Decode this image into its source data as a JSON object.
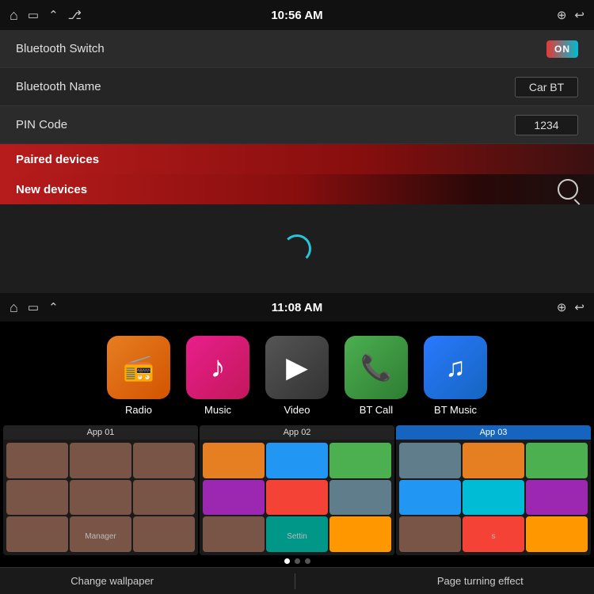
{
  "top_panel": {
    "status_bar": {
      "time": "10:56 AM",
      "icons_left": [
        "home",
        "screen",
        "chevron-up",
        "usb"
      ],
      "icons_right": [
        "location",
        "back"
      ]
    },
    "settings": [
      {
        "label": "Bluetooth Switch",
        "type": "toggle",
        "value": "ON"
      },
      {
        "label": "Bluetooth Name",
        "type": "value",
        "value": "Car BT"
      },
      {
        "label": "PIN Code",
        "type": "value",
        "value": "1234"
      }
    ],
    "sections": [
      {
        "label": "Paired devices",
        "type": "header"
      },
      {
        "label": "New devices",
        "type": "header-search"
      }
    ]
  },
  "bottom_panel": {
    "status_bar": {
      "time": "11:08 AM",
      "icons_left": [
        "home",
        "screen",
        "chevron-up"
      ],
      "icons_right": [
        "location",
        "back"
      ]
    },
    "apps": [
      {
        "id": "radio",
        "label": "Radio",
        "icon_class": "app-icon-radio",
        "icon_char": "📻"
      },
      {
        "id": "music",
        "label": "Music",
        "icon_class": "app-icon-music",
        "icon_char": "♪"
      },
      {
        "id": "video",
        "label": "Video",
        "icon_class": "app-icon-video",
        "icon_char": "▶"
      },
      {
        "id": "btcall",
        "label": "BT Call",
        "icon_class": "app-icon-btcall",
        "icon_char": "📞"
      },
      {
        "id": "btmusic",
        "label": "BT Music",
        "icon_class": "app-icon-btmusic",
        "icon_char": "♫"
      }
    ],
    "wallpapers": [
      {
        "title": "App 01",
        "active": false,
        "overlay": "Manager"
      },
      {
        "title": "App 02",
        "active": false,
        "overlay": "Settin"
      },
      {
        "title": "App 03",
        "active": true,
        "overlay": "s"
      }
    ],
    "dots": [
      true,
      false,
      false
    ],
    "bottom_actions": [
      {
        "label": "Change wallpaper",
        "id": "change-wallpaper"
      },
      {
        "label": "Page turning effect",
        "id": "page-effect"
      }
    ]
  }
}
